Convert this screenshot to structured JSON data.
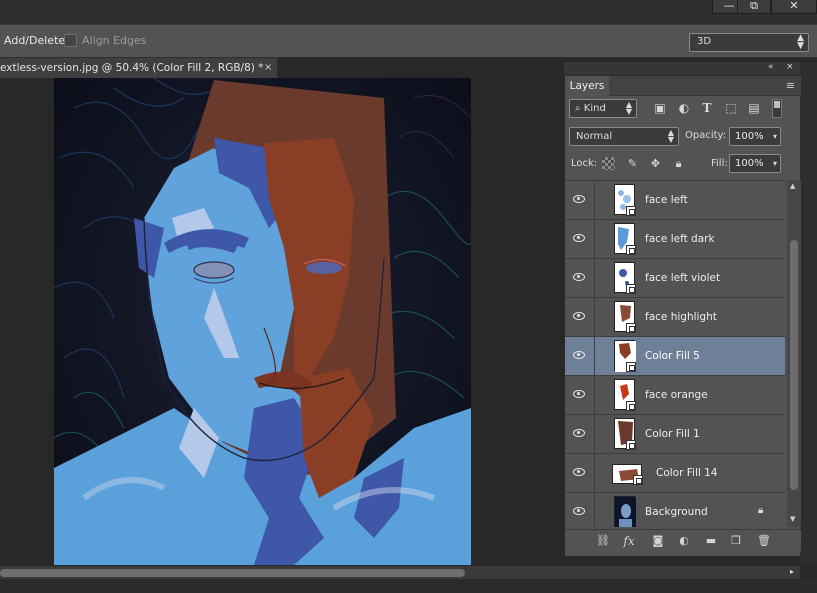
{
  "window_controls": {
    "minimize": "—",
    "restore": "⧉",
    "close": "✕"
  },
  "options_bar": {
    "add_delete_label": "Add/Delete",
    "align_edges_label": "Align Edges",
    "mode_select_value": "3D",
    "mode_select_arrows": "⇕"
  },
  "document": {
    "tab_title": "extless-version.jpg @ 50.4% (Color Fill 2, RGB/8) *",
    "tab_close": "×"
  },
  "layers_panel": {
    "collapse": "«",
    "close": "×",
    "tab_label": "Layers",
    "menu_icon": "≡",
    "kind_label": "⌕ Kind",
    "select_arrows": "⇕",
    "blend_mode": "Normal",
    "opacity_label": "Opacity:",
    "opacity_value": "100%",
    "lock_label": "Lock:",
    "fill_label": "Fill:",
    "fill_value": "100%",
    "field_arrow": "▾",
    "scroll_up": "▲",
    "scroll_down": "▼",
    "layers": [
      {
        "name": "face left",
        "thumbnail": "face-left",
        "mask": true
      },
      {
        "name": "face left dark",
        "thumbnail": "face-left-dark",
        "mask": true
      },
      {
        "name": "face left violet",
        "thumbnail": "face-left-violet",
        "mask": true
      },
      {
        "name": "face highlight",
        "thumbnail": "face-highlight",
        "mask": true
      },
      {
        "name": "Color Fill 5",
        "thumbnail": "color-fill-5",
        "mask": true,
        "selected": true
      },
      {
        "name": "face orange",
        "thumbnail": "face-orange",
        "mask": true
      },
      {
        "name": "Color Fill 1",
        "thumbnail": "color-fill-1",
        "mask": true
      },
      {
        "name": "Color Fill 14",
        "thumbnail": "color-fill-14",
        "mask": true
      },
      {
        "name": "Background",
        "thumbnail": "background-photo",
        "mask": false,
        "locked": true
      }
    ],
    "footer_icons": [
      "link-icon",
      "fx-icon",
      "mask-icon",
      "adjustment-icon",
      "group-icon",
      "new-layer-icon",
      "trash-icon"
    ],
    "fx_label": "fx"
  },
  "scroll": {
    "right_arrow": "▸"
  },
  "colors": {
    "panel_bg": "#535353",
    "selected_row": "#6e7f98",
    "skin_light_blue": "#5fa2dc",
    "skin_dark_blue": "#3f57a8",
    "rust": "#8b3e26",
    "brown_fill": "#6a3a2c"
  }
}
